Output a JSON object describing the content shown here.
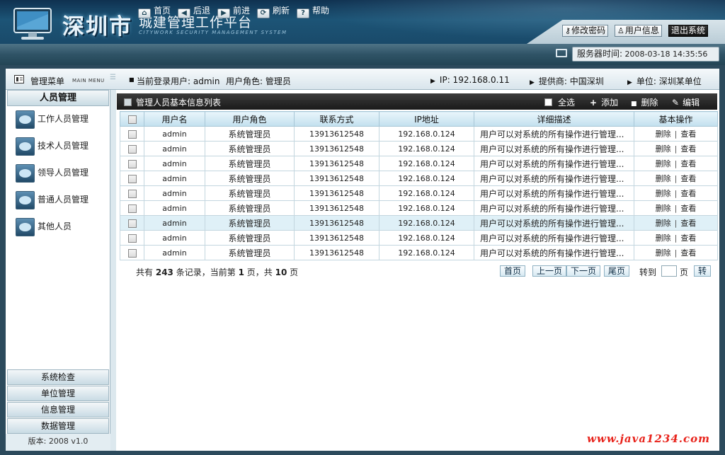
{
  "header": {
    "logo_main": "深圳市",
    "logo_title": "城建管理工作平台",
    "logo_subtitle": "CITYWORK SECURITY MANAGEMENT SYSTEM",
    "buttons": {
      "change_password": "修改密码",
      "user_info": "用户信息",
      "logout": "退出系统"
    }
  },
  "nav": {
    "home": "首页",
    "back": "后退",
    "forward": "前进",
    "refresh": "刷新",
    "help": "帮助",
    "server_time_label": "服务器时间:",
    "server_time_value": "2008-03-18 14:35:56"
  },
  "infobar": {
    "menu_title": "管理菜单",
    "menu_title_en": "MAIN MENU",
    "login_user": "当前登录用户: admin",
    "user_role": "用户角色: 管理员",
    "ip": "IP: 192.168.0.11",
    "provider": "提供商: 中国深圳",
    "unit": "单位: 深圳某单位"
  },
  "sidebar": {
    "section_title": "人员管理",
    "items": [
      {
        "label": "工作人员管理"
      },
      {
        "label": "技术人员管理"
      },
      {
        "label": "领导人员管理"
      },
      {
        "label": "普通人员管理"
      },
      {
        "label": "其他人员"
      }
    ],
    "bottom_sections": [
      {
        "label": "系统检查"
      },
      {
        "label": "单位管理"
      },
      {
        "label": "信息管理"
      },
      {
        "label": "数据管理"
      }
    ],
    "version": "版本: 2008 v1.0"
  },
  "panel": {
    "title": "管理人员基本信息列表",
    "select_all": "全选",
    "add": "添加",
    "delete": "删除",
    "edit": "编辑"
  },
  "table": {
    "columns": [
      "用户名",
      "用户角色",
      "联系方式",
      "IP地址",
      "详细描述",
      "基本操作"
    ],
    "rows": [
      {
        "username": "admin",
        "role": "系统管理员",
        "contact": "13913612548",
        "ip": "192.168.0.124",
        "desc": "用户可以对系统的所有操作进行管理...",
        "op_delete": "删除",
        "op_view": "查看"
      },
      {
        "username": "admin",
        "role": "系统管理员",
        "contact": "13913612548",
        "ip": "192.168.0.124",
        "desc": "用户可以对系统的所有操作进行管理...",
        "op_delete": "删除",
        "op_view": "查看"
      },
      {
        "username": "admin",
        "role": "系统管理员",
        "contact": "13913612548",
        "ip": "192.168.0.124",
        "desc": "用户可以对系统的所有操作进行管理...",
        "op_delete": "删除",
        "op_view": "查看"
      },
      {
        "username": "admin",
        "role": "系统管理员",
        "contact": "13913612548",
        "ip": "192.168.0.124",
        "desc": "用户可以对系统的所有操作进行管理...",
        "op_delete": "删除",
        "op_view": "查看"
      },
      {
        "username": "admin",
        "role": "系统管理员",
        "contact": "13913612548",
        "ip": "192.168.0.124",
        "desc": "用户可以对系统的所有操作进行管理...",
        "op_delete": "删除",
        "op_view": "查看"
      },
      {
        "username": "admin",
        "role": "系统管理员",
        "contact": "13913612548",
        "ip": "192.168.0.124",
        "desc": "用户可以对系统的所有操作进行管理...",
        "op_delete": "删除",
        "op_view": "查看"
      },
      {
        "username": "admin",
        "role": "系统管理员",
        "contact": "13913612548",
        "ip": "192.168.0.124",
        "desc": "用户可以对系统的所有操作进行管理...",
        "op_delete": "删除",
        "op_view": "查看"
      },
      {
        "username": "admin",
        "role": "系统管理员",
        "contact": "13913612548",
        "ip": "192.168.0.124",
        "desc": "用户可以对系统的所有操作进行管理...",
        "op_delete": "删除",
        "op_view": "查看"
      },
      {
        "username": "admin",
        "role": "系统管理员",
        "contact": "13913612548",
        "ip": "192.168.0.124",
        "desc": "用户可以对系统的所有操作进行管理...",
        "op_delete": "删除",
        "op_view": "查看"
      }
    ]
  },
  "pager": {
    "prefix": "共有",
    "total": "243",
    "mid1": "条记录，当前第",
    "current": "1",
    "mid2": "页，共",
    "pages": "10",
    "suffix": "页",
    "first": "首页",
    "prev": "上一页",
    "next": "下一页",
    "last": "尾页",
    "goto_label": "转到",
    "goto_unit": "页",
    "go": "转"
  },
  "watermark": "www.java1234.com"
}
